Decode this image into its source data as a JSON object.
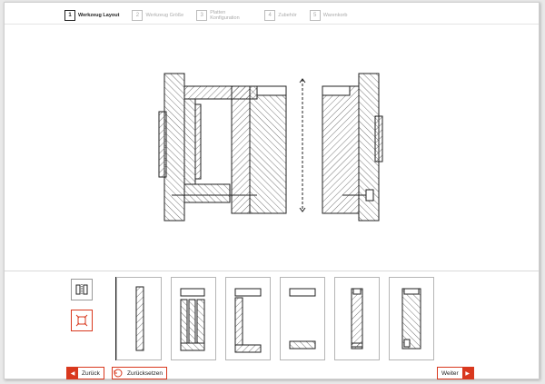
{
  "steps": [
    {
      "number": "1",
      "label": "Werkzeug Layout"
    },
    {
      "number": "2",
      "label": "Werkzeug Größe"
    },
    {
      "number": "3",
      "label": "Platten Konfiguration"
    },
    {
      "number": "4",
      "label": "Zubehör"
    },
    {
      "number": "5",
      "label": "Warenkorb"
    }
  ],
  "active_step": 1,
  "view_buttons": [
    {
      "icon": "split-mold-icon",
      "selected": false
    },
    {
      "icon": "expand-frame-icon",
      "selected": true
    }
  ],
  "thumbnails": [
    {
      "icon": "single-plate-icon"
    },
    {
      "icon": "clamp-plate-stack-icon"
    },
    {
      "icon": "c-frame-plate-icon"
    },
    {
      "icon": "two-plates-icon"
    },
    {
      "icon": "cavity-plate-icon"
    },
    {
      "icon": "mold-plate-icon"
    }
  ],
  "nav": {
    "back_label": "Zurück",
    "reset_label": "Zurücksetzen",
    "next_label": "Weiter"
  },
  "colors": {
    "accent": "#d9381e",
    "line": "#222222",
    "hatch": "#555555"
  }
}
